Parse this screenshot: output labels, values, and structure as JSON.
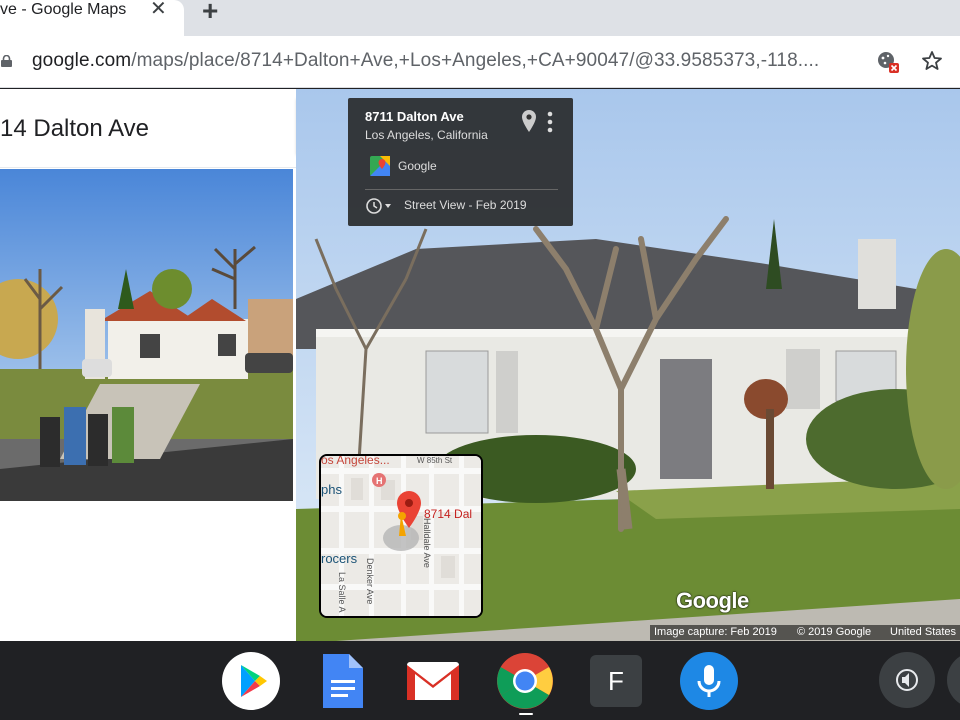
{
  "browser": {
    "tab_title": "ve - Google Maps",
    "tab_close": "✕",
    "new_tab": "+",
    "url_host": "google.com",
    "url_path": "/maps/place/8714+Dalton+Ave,+Los+Angeles,+CA+90047/@33.9585373,-118...."
  },
  "panel": {
    "place_title": "14 Dalton Ave"
  },
  "streetview": {
    "address": "8711 Dalton Ave",
    "city": "Los Angeles, California",
    "provider": "Google",
    "capture_label": "Street View - Feb 2019",
    "logo": "Google",
    "footer": {
      "capture": "Image capture: Feb 2019",
      "copyright": "© 2019 Google",
      "country": "United States"
    }
  },
  "minimap": {
    "label_top": "os Angeles...",
    "label_street": "W 85th St",
    "label_pin": "8714 Dal",
    "label_phs": "phs",
    "label_grocers": "rocers",
    "label_halldale": "Halldale Ave",
    "label_denker": "Denker Ave",
    "label_lasalle": "La Salle A"
  },
  "shelf": {
    "apps": [
      {
        "name": "play-store"
      },
      {
        "name": "google-docs"
      },
      {
        "name": "gmail"
      },
      {
        "name": "chrome"
      },
      {
        "name": "f-app",
        "label": "F"
      },
      {
        "name": "assistant-voice"
      }
    ]
  },
  "colors": {
    "map_pin": "#ea4335",
    "assistant": "#1e88e5",
    "shelf": "#202124"
  }
}
